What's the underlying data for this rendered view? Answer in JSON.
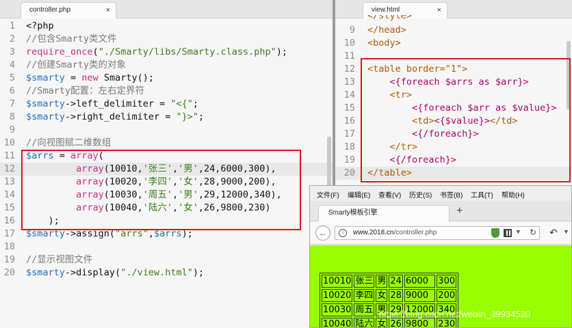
{
  "colors": {
    "editor_bg": "#f6f6f6",
    "highlight_box": "#e3101b",
    "browser_content_bg": "#99ff00"
  },
  "editor_left": {
    "tab_title": "controller.php",
    "close_icon": "×",
    "line_numbers": [
      "1",
      "2",
      "3",
      "4",
      "5",
      "6",
      "7",
      "8",
      "9",
      "10",
      "11",
      "12",
      "13",
      "14",
      "15",
      "16",
      "17",
      "18",
      "19",
      "20"
    ],
    "lines": [
      "<?php",
      "//包含Smarty类文件",
      "require_once(\"./Smarty/libs/Smarty.class.php\");",
      "//创建Smarty类的对象",
      "$smarty = new Smarty();",
      "//Smarty配置：左右定界符",
      "$smarty->left_delimiter = \"<{\";",
      "$smarty->right_delimiter = \"}>\";",
      "",
      "//向视图赋二维数组",
      "$arrs = array(",
      "         array(10010,'张三','男',24,6000,300),",
      "         array(10020,'李四','女',28,9000,200),",
      "         array(10030,'周五','男',29,12000,340),",
      "         array(10040,'陆六','女',26,9800,230)",
      "    );",
      "$smarty->assign(\"arrs\",$arrs);",
      "",
      "//显示视图文件",
      "$smarty->display(\"./view.html\");"
    ]
  },
  "editor_right": {
    "tab_title": "view.html",
    "close_icon": "×",
    "partial_top_line": "</style>",
    "line_numbers": [
      "9",
      "10",
      "11",
      "12",
      "13",
      "14",
      "15",
      "16",
      "17",
      "18",
      "19",
      "20"
    ],
    "lines": [
      "</head>",
      "<body>",
      "",
      "<table border=\"1\">",
      "    <{foreach $arrs as $arr}>",
      "    <tr>",
      "        <{foreach $arr as $value}>",
      "        <td><{$value}></td>",
      "        <{/foreach}>",
      "    </tr>",
      "    <{/foreach}>",
      "</table>"
    ]
  },
  "browser": {
    "menu": [
      "文件(F)",
      "编辑(E)",
      "查看(V)",
      "历史(S)",
      "书签(B)",
      "工具(T)",
      "帮助(H)"
    ],
    "tab_title": "Smarty模板引擎",
    "new_tab_icon": "+",
    "url_host": "www.2018.cn",
    "url_path": "/controller.php",
    "table_rows": [
      [
        "10010",
        "张三",
        "男",
        "24",
        "6000",
        "300"
      ],
      [
        "10020",
        "李四",
        "女",
        "28",
        "9000",
        "200"
      ],
      [
        "10030",
        "周五",
        "男",
        "29",
        "12000",
        "340"
      ],
      [
        "10040",
        "陆六",
        "女",
        "26",
        "9800",
        "230"
      ]
    ]
  },
  "watermark": "https://blog.csdn.net/weixin_39934520",
  "icons": [
    "close-icon",
    "back-arrow-icon",
    "info-icon",
    "shield-icon",
    "qr-code-icon",
    "dropdown-icon",
    "reload-icon",
    "undo-icon",
    "more-icon",
    "new-tab-icon"
  ]
}
